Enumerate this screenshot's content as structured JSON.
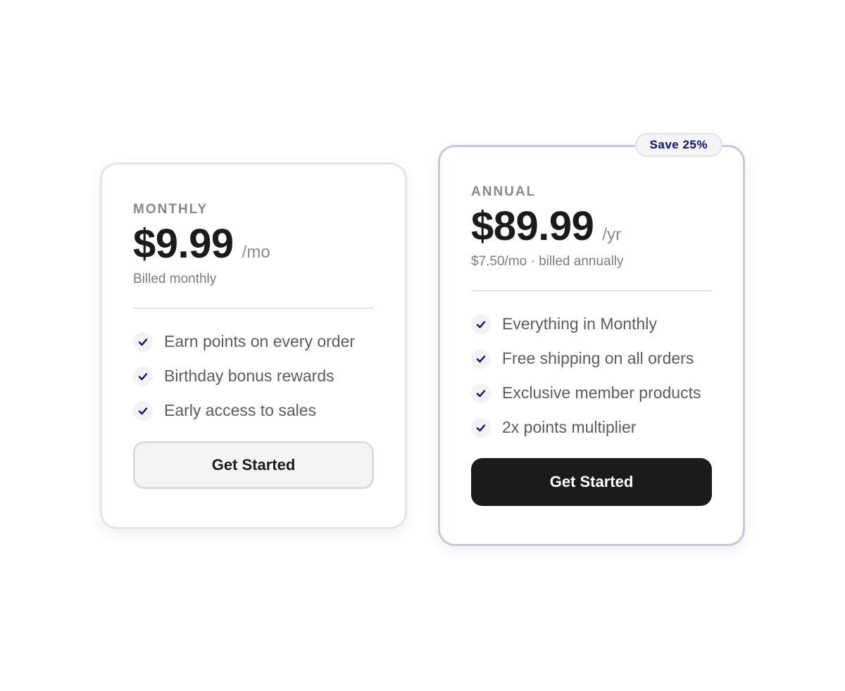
{
  "colors": {
    "accent": "#0d0d7a",
    "text_dark": "#1b1b1b",
    "text_muted": "#888888",
    "border": "#e4e4e6",
    "highlight_border": "#c8c6dd",
    "primary_button": "#1b1b1b",
    "secondary_button": "#f4f4f4"
  },
  "plans": {
    "monthly": {
      "label": "MONTHLY",
      "price": "$9.99",
      "period": "/mo",
      "billing": "Billed monthly",
      "features": [
        "Earn points on every order",
        "Birthday bonus rewards",
        "Early access to sales"
      ],
      "cta_label": "Get Started"
    },
    "annual": {
      "badge": "Save 25%",
      "label": "ANNUAL",
      "price": "$89.99",
      "period": "/yr",
      "billing": "$7.50/mo · billed annually",
      "features": [
        "Everything in Monthly",
        "Free shipping on all orders",
        "Exclusive member products",
        "2x points multiplier"
      ],
      "cta_label": "Get Started"
    }
  },
  "icons": {
    "feature_check": "check-icon"
  }
}
